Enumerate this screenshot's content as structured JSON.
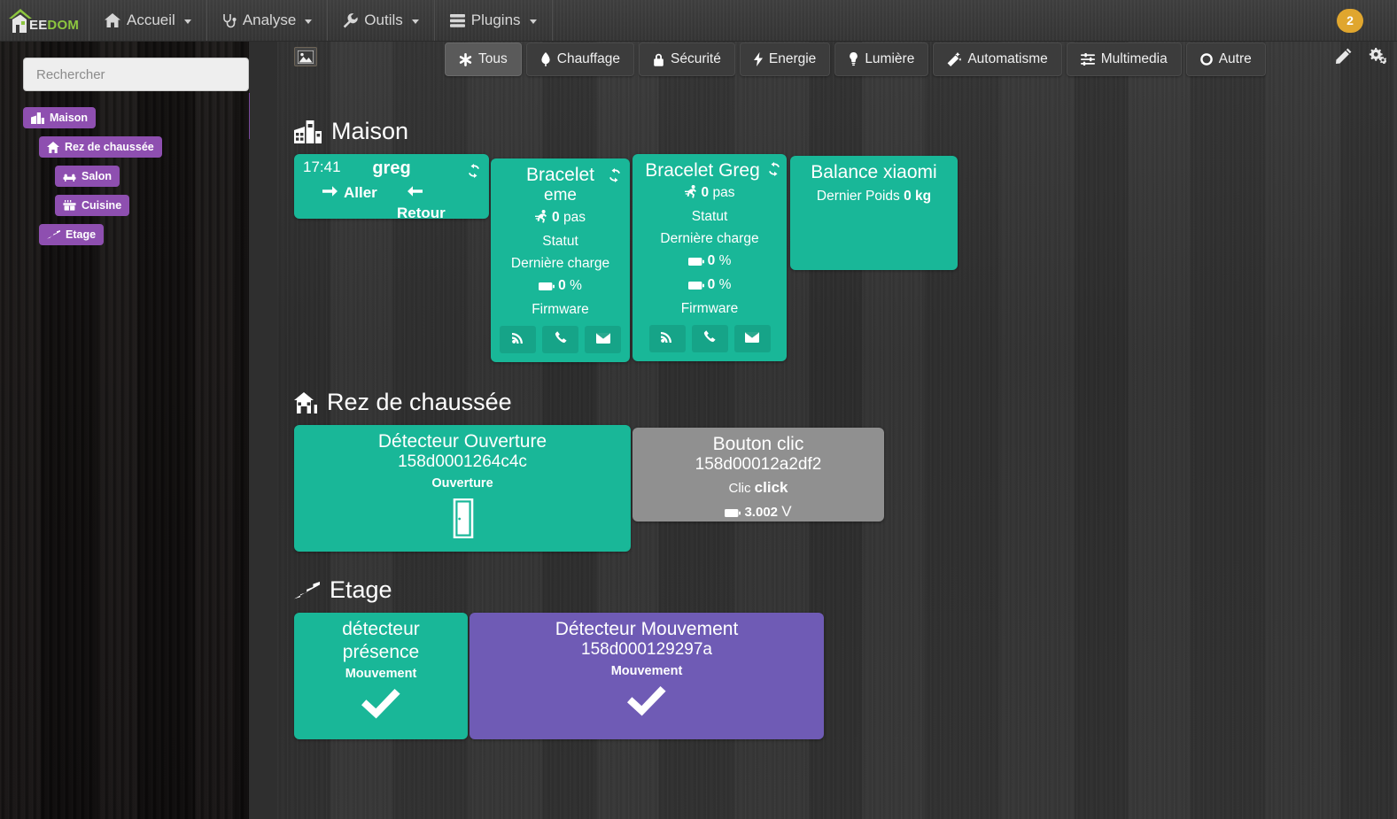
{
  "brand": {
    "ee": "EE",
    "dom": "DOM",
    "logo_icon": "jeedom-house-logo"
  },
  "topnav": {
    "items": [
      {
        "label": "Accueil",
        "icon": "home-icon",
        "caret": true
      },
      {
        "label": "Analyse",
        "icon": "stethoscope-icon",
        "caret": true
      },
      {
        "label": "Outils",
        "icon": "wrench-icon",
        "caret": true
      },
      {
        "label": "Plugins",
        "icon": "server-icon",
        "caret": true
      }
    ],
    "user_badge": "2"
  },
  "sidebar": {
    "search": {
      "placeholder": "Rechercher",
      "value": "",
      "icon": "search-input"
    },
    "tree": [
      {
        "label": "Maison",
        "icon": "buildings-icon",
        "level": 0
      },
      {
        "label": "Rez de chaussée",
        "icon": "home-icon",
        "level": 1
      },
      {
        "label": "Salon",
        "icon": "couch-icon",
        "level": 2
      },
      {
        "label": "Cuisine",
        "icon": "kitchen-icon",
        "level": 2
      },
      {
        "label": "Etage",
        "icon": "stairs-icon",
        "level": 1
      }
    ]
  },
  "toolbar": {
    "broken_image_icon": "broken-image-icon",
    "edit_icon": "pencil-icon",
    "settings_icon": "gears-icon",
    "tabs": [
      {
        "label": "Tous",
        "icon": "asterisk-icon",
        "active": true
      },
      {
        "label": "Chauffage",
        "icon": "fire-icon",
        "active": false
      },
      {
        "label": "Sécurité",
        "icon": "lock-icon",
        "active": false
      },
      {
        "label": "Energie",
        "icon": "bolt-icon",
        "active": false
      },
      {
        "label": "Lumière",
        "icon": "lightbulb-icon",
        "active": false
      },
      {
        "label": "Automatisme",
        "icon": "magic-wand-icon",
        "active": false
      },
      {
        "label": "Multimedia",
        "icon": "sliders-icon",
        "active": false
      },
      {
        "label": "Autre",
        "icon": "circle-icon",
        "active": false
      }
    ]
  },
  "sections": [
    {
      "title": "Maison",
      "icon": "buildings-icon",
      "cards": {
        "greg": {
          "time": "17:41",
          "name": "greg",
          "aller_label": "Aller",
          "retour_label": "Retour",
          "refresh_icon": "refresh-icon",
          "aller_icon": "arrow-right-icon",
          "retour_icon": "arrow-left-icon",
          "color": "#19b798"
        },
        "bracelet_eme": {
          "title": "Bracelet",
          "subtitle": "eme",
          "refresh_icon": "refresh-icon",
          "steps_value": "0",
          "steps_unit": "pas",
          "steps_icon": "running-icon",
          "statut_label": "Statut",
          "charge_label": "Dernière charge",
          "battery_value": "0",
          "battery_unit": "%",
          "battery_icon": "battery-icon",
          "firmware_label": "Firmware",
          "actions": [
            "rss-icon",
            "phone-icon",
            "envelope-icon"
          ],
          "color": "#19b798"
        },
        "bracelet_greg": {
          "title": "Bracelet Greg",
          "refresh_icon": "refresh-icon",
          "steps_value": "0",
          "steps_unit": "pas",
          "steps_icon": "running-icon",
          "statut_label": "Statut",
          "charge_label": "Dernière charge",
          "battery1_value": "0",
          "battery1_unit": "%",
          "battery2_value": "0",
          "battery2_unit": "%",
          "battery_icon": "battery-icon",
          "firmware_label": "Firmware",
          "actions": [
            "rss-icon",
            "phone-icon",
            "envelope-icon"
          ],
          "color": "#19b798"
        },
        "balance": {
          "title": "Balance xiaomi",
          "weight_label": "Dernier Poids",
          "weight_value": "0",
          "weight_unit": "kg",
          "color": "#19b798"
        }
      }
    },
    {
      "title": "Rez de chaussée",
      "icon": "home-icon",
      "cards": {
        "ouverture": {
          "title": "Détecteur Ouverture",
          "id": "158d0001264c4c",
          "state_label": "Ouverture",
          "state_icon": "door-open-icon",
          "color": "#19b798"
        },
        "bouton": {
          "title": "Bouton clic",
          "id": "158d00012a2df2",
          "clic_label": "Clic",
          "clic_value": "click",
          "battery_icon": "battery-icon",
          "battery_value": "3.002",
          "battery_unit": "V",
          "color": "#909090"
        }
      }
    },
    {
      "title": "Etage",
      "icon": "stairs-icon",
      "cards": {
        "presence": {
          "title": "détecteur",
          "subtitle": "présence",
          "state_label": "Mouvement",
          "state_icon": "check-icon",
          "color": "#19b798"
        },
        "mouvement": {
          "title": "Détecteur Mouvement",
          "id": "158d000129297a",
          "state_label": "Mouvement",
          "state_icon": "check-icon",
          "color": "#6f5bb5"
        }
      }
    }
  ],
  "colors": {
    "accent_teal": "#19b798",
    "accent_purple": "#6f5bb5",
    "accent_gray": "#909090",
    "sidebar_badge": "#8e4fb0",
    "badge_orange": "#e0a62e",
    "logo_green": "#8dc63f"
  }
}
